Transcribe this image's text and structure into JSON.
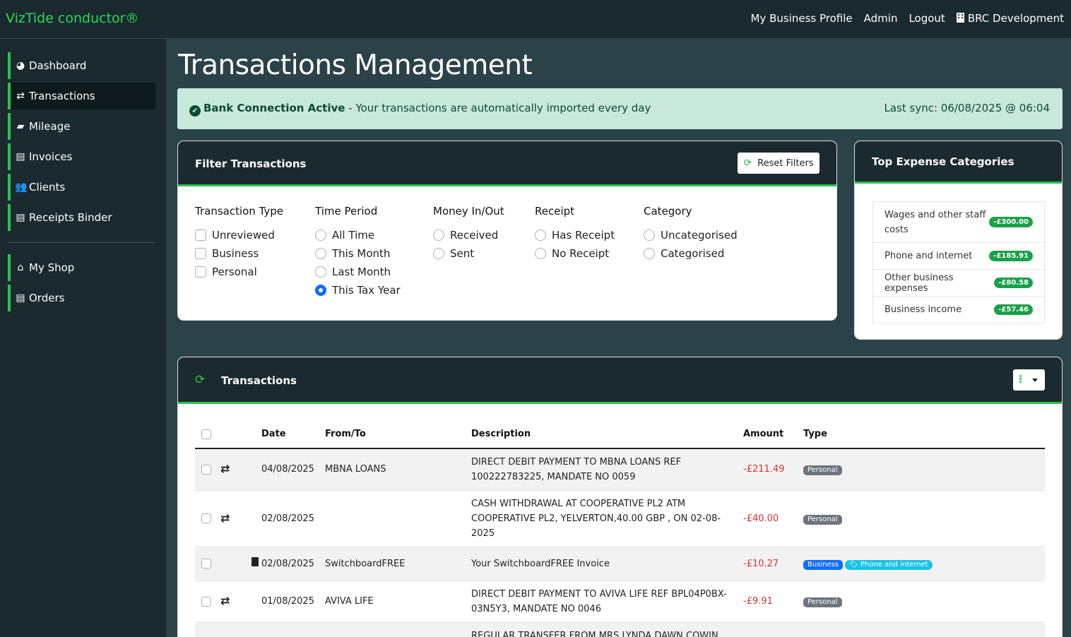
{
  "brand": "VizTide conductor®",
  "topnav": {
    "profile": "My Business Profile",
    "admin": "Admin",
    "logout": "Logout",
    "org": "BRC Development"
  },
  "sidebar": [
    {
      "label": "Dashboard",
      "icon": "tachometer-icon"
    },
    {
      "label": "Transactions",
      "icon": "exchange-icon",
      "active": true
    },
    {
      "label": "Mileage",
      "icon": "car-icon"
    },
    {
      "label": "Invoices",
      "icon": "invoice-icon"
    },
    {
      "label": "Clients",
      "icon": "users-icon"
    },
    {
      "label": "Receipts Binder",
      "icon": "receipt-icon"
    },
    {
      "label": "My Shop",
      "icon": "store-icon"
    },
    {
      "label": "Orders",
      "icon": "clipboard-icon"
    }
  ],
  "page_title": "Transactions Management",
  "alert": {
    "strong": "Bank Connection Active",
    "text": " - Your transactions are automatically imported every day",
    "sync": "Last sync: 06/08/2025 @ 06:04"
  },
  "filters": {
    "title": "Filter Transactions",
    "reset": "Reset Filters",
    "groups": [
      {
        "heading": "Transaction Type",
        "kind": "checkbox",
        "options": [
          "Unreviewed",
          "Business",
          "Personal"
        ]
      },
      {
        "heading": "Time Period",
        "kind": "radio",
        "options": [
          "All Time",
          "This Month",
          "Last Month",
          "This Tax Year"
        ],
        "selected": "This Tax Year"
      },
      {
        "heading": "Money In/Out",
        "kind": "radio",
        "options": [
          "Received",
          "Sent"
        ]
      },
      {
        "heading": "Receipt",
        "kind": "radio",
        "options": [
          "Has Receipt",
          "No Receipt"
        ]
      },
      {
        "heading": "Category",
        "kind": "radio",
        "options": [
          "Uncategorised",
          "Categorised"
        ]
      }
    ]
  },
  "top_expenses": {
    "title": "Top Expense Categories",
    "items": [
      {
        "name": "Wages and other staff costs",
        "amount": "-£300.00"
      },
      {
        "name": "Phone and internet",
        "amount": "-£185.91"
      },
      {
        "name": "Other business expenses",
        "amount": "-£80.58"
      },
      {
        "name": "Business income",
        "amount": "-£57.46"
      }
    ]
  },
  "transactions": {
    "title": "Transactions",
    "columns": {
      "date": "Date",
      "from_to": "From/To",
      "description": "Description",
      "amount": "Amount",
      "type": "Type"
    },
    "rows": [
      {
        "icon": "swap",
        "date": "04/08/2025",
        "from_to": "MBNA LOANS",
        "description": "DIRECT DEBIT PAYMENT TO MBNA LOANS REF 100222783225, MANDATE NO 0059",
        "amount": "-£211.49",
        "badges": [
          "Personal"
        ]
      },
      {
        "icon": "swap",
        "date": "02/08/2025",
        "from_to": "",
        "description": "CASH WITHDRAWAL AT COOPERATIVE PL2 ATM COOPERATIVE PL2, YELVERTON,40.00 GBP , ON 02-08-2025",
        "amount": "-£40.00",
        "badges": [
          "Personal"
        ]
      },
      {
        "icon": "file",
        "date": "02/08/2025",
        "from_to": "SwitchboardFREE",
        "description": "Your SwitchboardFREE Invoice",
        "amount": "-£10.27",
        "badges": [
          "Business"
        ],
        "category": "Phone and internet"
      },
      {
        "icon": "swap",
        "date": "01/08/2025",
        "from_to": "AVIVA LIFE",
        "description": "DIRECT DEBIT PAYMENT TO AVIVA LIFE REF BPL04P0BX-03N5Y3, MANDATE NO 0046",
        "amount": "-£9.91",
        "badges": [
          "Personal"
        ]
      },
      {
        "icon": "swap",
        "date": "",
        "from_to": "",
        "description": "REGULAR TRANSFER FROM MRS LYNDA DAWN COWIN",
        "amount": "",
        "badges": []
      }
    ]
  },
  "colors": {
    "accent": "#2bc24e",
    "dark": "#1a2a2e",
    "background": "#2b4248",
    "negative": "#d9332e",
    "alert_bg": "#c8e8dc"
  }
}
